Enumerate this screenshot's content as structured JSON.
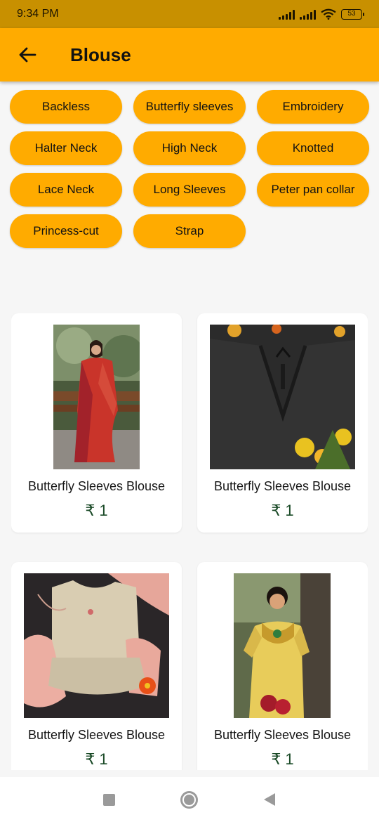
{
  "status_bar": {
    "time": "9:34 PM",
    "battery": "53"
  },
  "app_bar": {
    "title": "Blouse",
    "back_icon": "arrow-left-icon"
  },
  "filters": [
    "Backless",
    "Butterfly sleeves",
    "Embroidery",
    "Halter Neck",
    "High Neck",
    "Knotted",
    "Lace Neck",
    "Long Sleeves",
    "Peter pan collar",
    "Princess-cut",
    "Strap"
  ],
  "products": [
    {
      "title": "Butterfly Sleeves Blouse",
      "price": "₹ 1"
    },
    {
      "title": "Butterfly Sleeves Blouse",
      "price": "₹ 1"
    },
    {
      "title": "Butterfly Sleeves Blouse",
      "price": "₹ 1"
    },
    {
      "title": "Butterfly Sleeves Blouse",
      "price": "₹ 1"
    }
  ],
  "nav_bar": {
    "icons": [
      "recents-square-icon",
      "home-circle-icon",
      "back-triangle-icon"
    ]
  },
  "colors": {
    "accent": "#ffab00",
    "status_bar": "#c89000",
    "price": "#1a4a27"
  }
}
